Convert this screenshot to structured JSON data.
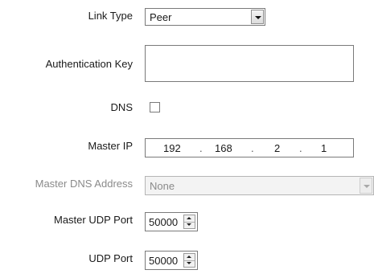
{
  "form": {
    "link_type": {
      "label": "Link Type",
      "value": "Peer"
    },
    "authentication_key": {
      "label": "Authentication Key",
      "value": ""
    },
    "dns": {
      "label": "DNS",
      "checked": false
    },
    "master_ip": {
      "label": "Master IP",
      "octets": [
        "192",
        "168",
        "2",
        "1"
      ],
      "separator": "."
    },
    "master_dns_address": {
      "label": "Master DNS Address",
      "value": "None",
      "enabled": false
    },
    "master_udp_port": {
      "label": "Master UDP Port",
      "value": "50000"
    },
    "udp_port": {
      "label": "UDP Port",
      "value": "50000"
    }
  },
  "icons": {
    "dropdown": "chevron-down-icon",
    "spinner": "spinner-arrows-icon"
  }
}
